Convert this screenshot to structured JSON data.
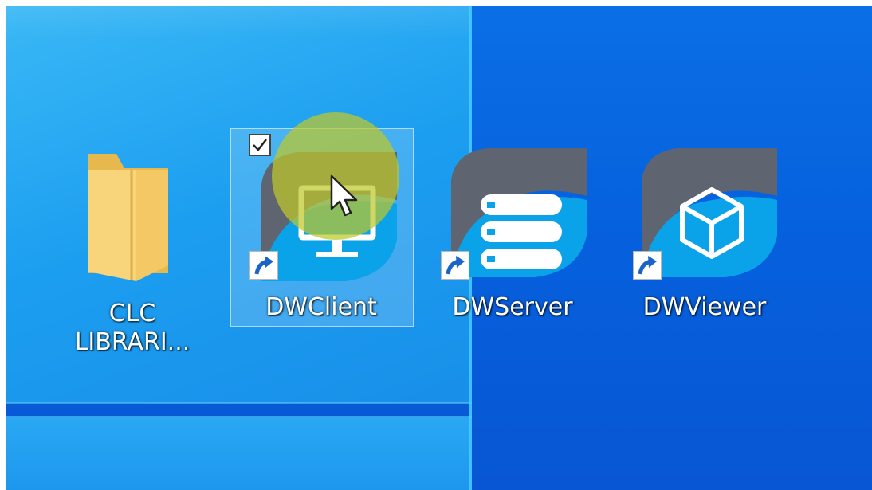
{
  "desktop": {
    "icons": [
      {
        "label_line1": "CLC",
        "label_line2": "LIBRARI...",
        "icon": "folder-icon"
      },
      {
        "label": "DWClient",
        "icon": "dwclient-monitor-icon",
        "selected": true,
        "checked": true
      },
      {
        "label": "DWServer",
        "icon": "dwserver-database-icon"
      },
      {
        "label": "DWViewer",
        "icon": "dwviewer-cube-icon"
      }
    ]
  },
  "colors": {
    "desktop_dark_blue": "#0856d3",
    "pane_light_blue": "#1c9ef0",
    "app_icon_blue": "#0aa2e8",
    "app_icon_gray": "#5f6570",
    "cursor_highlight": "#bec828",
    "folder_yellow": "#f8d57a"
  }
}
